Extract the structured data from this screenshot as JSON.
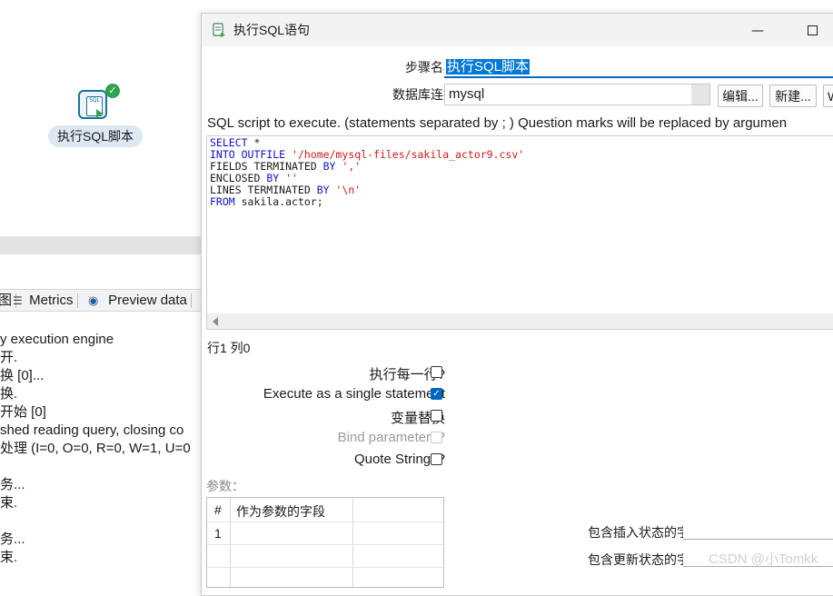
{
  "canvas": {
    "step_label": "执行SQL脚本",
    "step_icon": "sql-script-icon",
    "status_icon": "checkmark-icon"
  },
  "log_panel": {
    "tabs": [
      {
        "label": "图",
        "icon": "image-icon"
      },
      {
        "label": "Metrics",
        "icon": "metrics-icon"
      },
      {
        "label": "Preview data",
        "icon": "eye-icon"
      }
    ],
    "lines": [
      "y execution engine",
      "开.",
      "换 [0]...",
      "换.",
      "开始  [0]",
      "shed reading query, closing co",
      "处理 (I=0, O=0, R=0, W=1, U=0",
      "",
      "务...",
      "束.",
      "",
      "务...",
      "束."
    ]
  },
  "dialog": {
    "title": "执行SQL语句",
    "title_icon": "sql-script-icon",
    "minimize_icon": "minimize-icon",
    "maximize_icon": "maximize-icon",
    "step_name_label": "步骤名称",
    "step_name_value": "执行SQL脚本",
    "db_label": "数据库连接",
    "db_value": "mysql",
    "edit_button": "编辑...",
    "new_button": "新建...",
    "wizard_button": "W",
    "sql_description": "SQL script to execute. (statements separated by ; ) Question marks will be replaced by argumen",
    "sql_lines": [
      [
        {
          "t": "SELECT",
          "c": "kw"
        },
        {
          "t": " *",
          "c": ""
        }
      ],
      [
        {
          "t": "INTO OUTFILE",
          "c": "kw"
        },
        {
          "t": " ",
          "c": ""
        },
        {
          "t": "'/home/mysql-files/sakila_actor9.csv'",
          "c": "str"
        }
      ],
      [
        {
          "t": "FIELDS TERMINATED ",
          "c": ""
        },
        {
          "t": "BY",
          "c": "kw"
        },
        {
          "t": " ",
          "c": ""
        },
        {
          "t": "','",
          "c": "str"
        }
      ],
      [
        {
          "t": "ENCLOSED ",
          "c": ""
        },
        {
          "t": "BY",
          "c": "kw"
        },
        {
          "t": " ",
          "c": ""
        },
        {
          "t": "''",
          "c": "str"
        }
      ],
      [
        {
          "t": "LINES TERMINATED ",
          "c": ""
        },
        {
          "t": "BY",
          "c": "kw"
        },
        {
          "t": " ",
          "c": ""
        },
        {
          "t": "'\\n'",
          "c": "str"
        }
      ],
      [
        {
          "t": "FROM",
          "c": "kw"
        },
        {
          "t": " sakila.actor;",
          "c": ""
        }
      ]
    ],
    "cursor_position": "行1 列0",
    "options": [
      {
        "label": "执行每一行?",
        "checked": false,
        "disabled": false
      },
      {
        "label": "Execute as a single statement",
        "checked": true,
        "disabled": false
      },
      {
        "label": "变量替换",
        "checked": false,
        "disabled": false
      },
      {
        "label": "Bind parameters?",
        "checked": false,
        "disabled": true
      },
      {
        "label": "Quote Strings?",
        "checked": false,
        "disabled": false
      }
    ],
    "params_label": "参数：",
    "params_table": {
      "headers": [
        "#",
        "作为参数的字段"
      ],
      "rows": [
        [
          "1",
          ""
        ]
      ]
    },
    "insert_status_label": "包含插入状态的字段",
    "update_status_label": "包含更新状态的字段"
  },
  "watermark": "CSDN @小Tomkk",
  "colors": {
    "accent": "#0067c0",
    "sql_keyword": "#1010c8",
    "sql_string": "#d01818",
    "success": "#2ea44f"
  }
}
